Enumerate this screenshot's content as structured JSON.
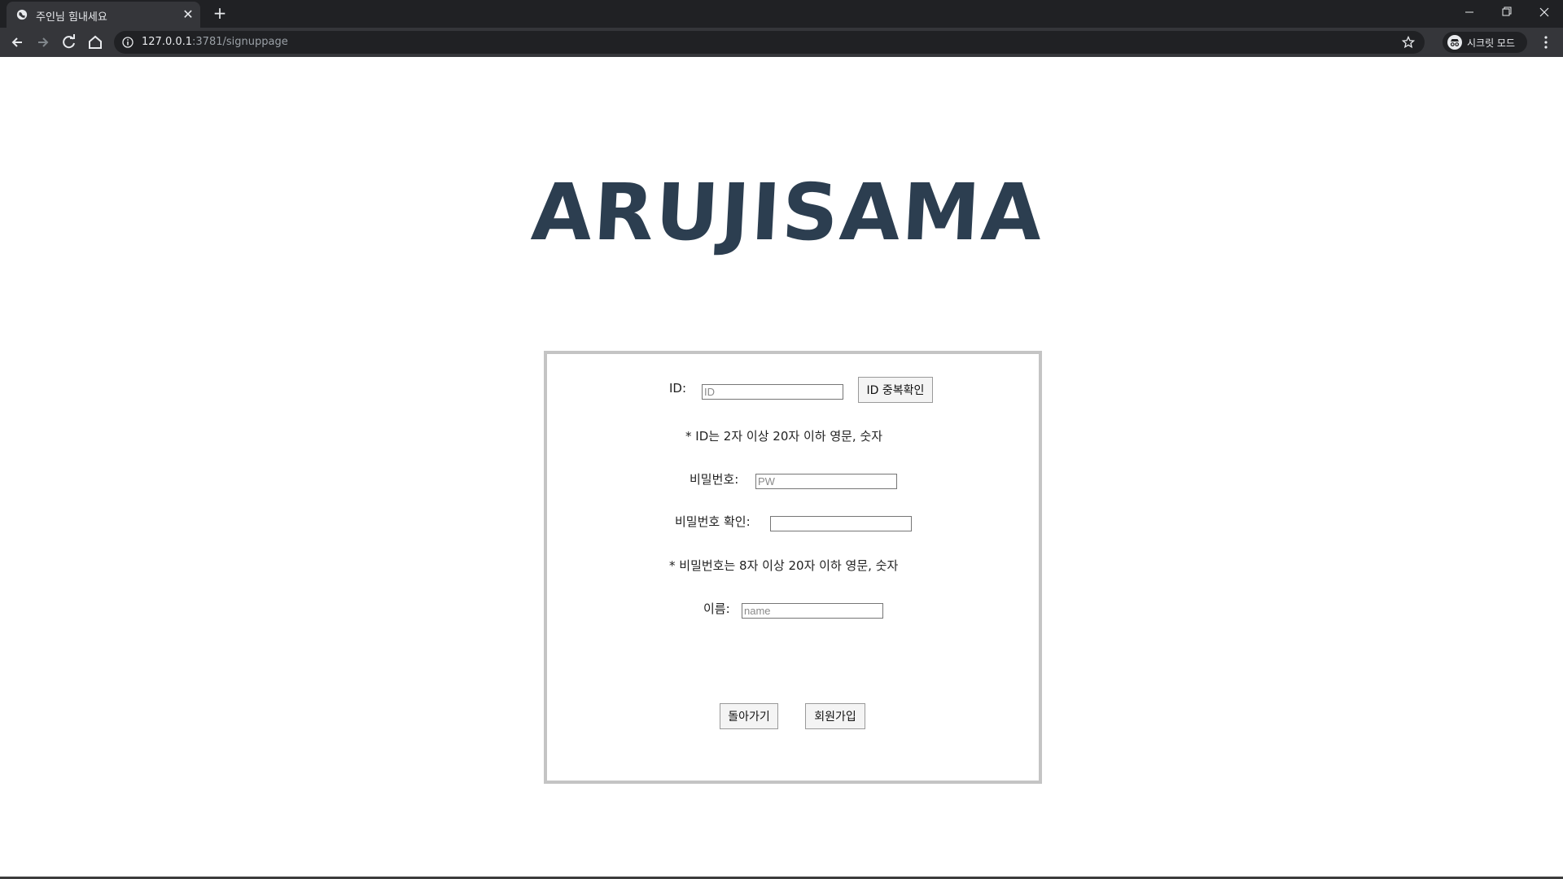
{
  "browser": {
    "tab_title": "주인님 힘내세요",
    "tab_close": "✕",
    "new_tab": "+",
    "url_host": "127.0.0.1",
    "url_path": ":3781/signuppage",
    "incognito_label": "시크릿 모드"
  },
  "page": {
    "logo_text": "ARUJISAMA"
  },
  "form": {
    "id_label": "ID:",
    "id_placeholder": "ID",
    "id_check_button": "ID 중복확인",
    "id_hint": "* ID는 2자 이상 20자 이하 영문, 숫자",
    "pw_label": "비밀번호:",
    "pw_placeholder": "PW",
    "pw_confirm_label": "비밀번호 확인:",
    "pw_confirm_placeholder": "",
    "pw_hint": "* 비밀번호는 8자 이상 20자 이하 영문, 숫자",
    "name_label": "이름:",
    "name_placeholder": "name",
    "back_button": "돌아가기",
    "signup_button": "회원가입"
  },
  "colors": {
    "logo": "#2c3e50",
    "box_border": "#c4c4c4",
    "chrome_dark": "#202124",
    "chrome_toolbar": "#35363a"
  }
}
